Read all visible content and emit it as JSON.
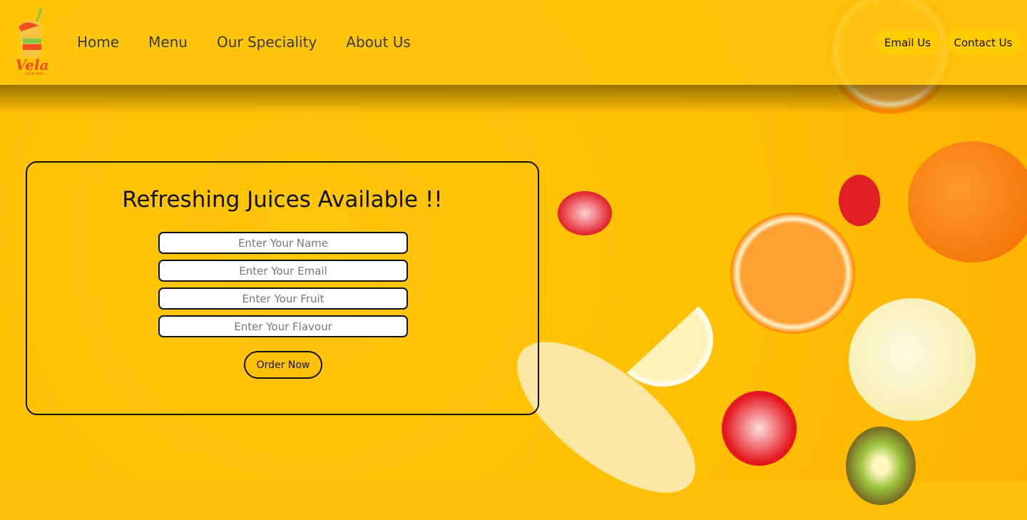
{
  "brand": {
    "name": "Vela",
    "tagline": "JUICE BAR"
  },
  "nav": [
    "Home",
    "Menu",
    "Our Speciality",
    "About Us"
  ],
  "header_buttons": {
    "email": "Email Us",
    "contact": "Contact Us"
  },
  "form": {
    "title": "Refreshing Juices Available !!",
    "name_placeholder": "Enter Your Name",
    "email_placeholder": "Enter Your Email",
    "fruit_placeholder": "Enter Your Fruit",
    "flavour_placeholder": "Enter Your Flavour",
    "submit": "Order Now"
  }
}
